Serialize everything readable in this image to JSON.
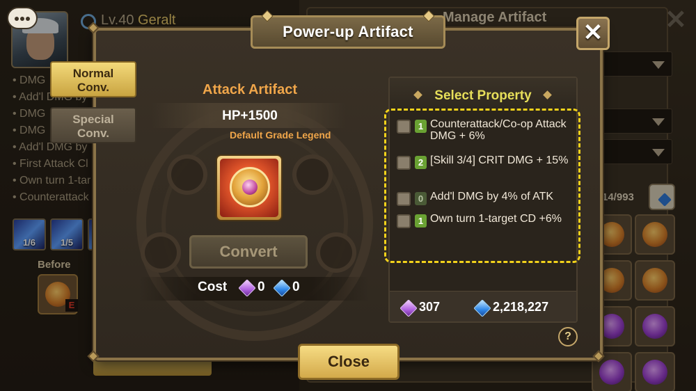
{
  "background": {
    "hero_level": "Lv.40",
    "hero_name": "Geralt",
    "manage_title": "Manage Artifact",
    "stat_lines": [
      "DMG",
      "Add'l DMG by",
      "DMG",
      "DMG",
      "Add'l DMG by",
      "First Attack Cl",
      "Own turn 1-tar",
      "Counterattack"
    ],
    "skills": [
      "1/6",
      "1/5"
    ],
    "before_label": "Before",
    "e_badge": "E",
    "inventory_count": "14/993"
  },
  "dialog": {
    "title": "Power-up Artifact",
    "close_icon": "close-icon",
    "tabs": [
      "Normal Conv.",
      "Special Conv."
    ],
    "tab_line1": [
      "Normal",
      "Special"
    ],
    "tab_line2": [
      "Conv.",
      "Conv."
    ],
    "artifact_name": "Attack Artifact",
    "main_stat": "HP+1500",
    "grade_text": "Default Grade Legend",
    "convert_label": "Convert",
    "cost_label": "Cost",
    "cost_crystal": "0",
    "cost_mana": "0",
    "select_property_title": "Select Property",
    "properties": [
      {
        "level": "1",
        "text": "Counterattack/Co-op Attack DMG + 6%"
      },
      {
        "level": "2",
        "text": "[Skill 3/4] CRIT DMG + 15%"
      },
      {
        "level": "0",
        "text": "Add'l DMG by 4% of ATK"
      },
      {
        "level": "1",
        "text": "Own turn 1-target CD +6%"
      }
    ],
    "crystals_owned": "307",
    "mana_owned": "2,218,227",
    "help_label": "?",
    "close_button_label": "Close"
  },
  "colors": {
    "highlight_border": "#f2d21b",
    "title_gold": "#f0a64a",
    "select_property": "#e7df5a",
    "level_badge_green": "#6aa233"
  }
}
